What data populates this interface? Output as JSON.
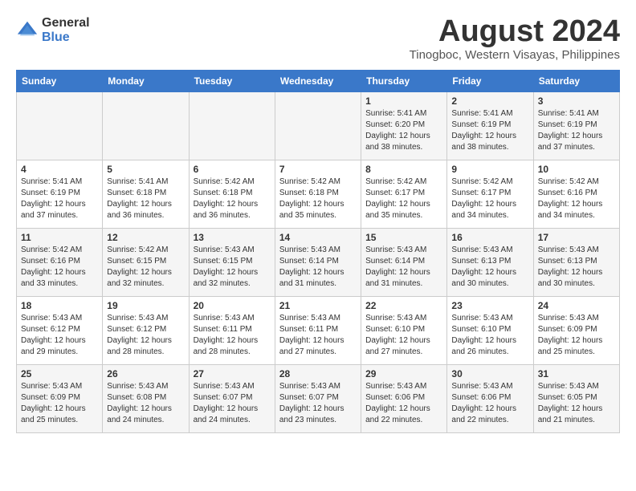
{
  "header": {
    "logo_general": "General",
    "logo_blue": "Blue",
    "month_year": "August 2024",
    "location": "Tinogboc, Western Visayas, Philippines"
  },
  "days_of_week": [
    "Sunday",
    "Monday",
    "Tuesday",
    "Wednesday",
    "Thursday",
    "Friday",
    "Saturday"
  ],
  "weeks": [
    [
      {
        "day": "",
        "info": ""
      },
      {
        "day": "",
        "info": ""
      },
      {
        "day": "",
        "info": ""
      },
      {
        "day": "",
        "info": ""
      },
      {
        "day": "1",
        "info": "Sunrise: 5:41 AM\nSunset: 6:20 PM\nDaylight: 12 hours\nand 38 minutes."
      },
      {
        "day": "2",
        "info": "Sunrise: 5:41 AM\nSunset: 6:19 PM\nDaylight: 12 hours\nand 38 minutes."
      },
      {
        "day": "3",
        "info": "Sunrise: 5:41 AM\nSunset: 6:19 PM\nDaylight: 12 hours\nand 37 minutes."
      }
    ],
    [
      {
        "day": "4",
        "info": "Sunrise: 5:41 AM\nSunset: 6:19 PM\nDaylight: 12 hours\nand 37 minutes."
      },
      {
        "day": "5",
        "info": "Sunrise: 5:41 AM\nSunset: 6:18 PM\nDaylight: 12 hours\nand 36 minutes."
      },
      {
        "day": "6",
        "info": "Sunrise: 5:42 AM\nSunset: 6:18 PM\nDaylight: 12 hours\nand 36 minutes."
      },
      {
        "day": "7",
        "info": "Sunrise: 5:42 AM\nSunset: 6:18 PM\nDaylight: 12 hours\nand 35 minutes."
      },
      {
        "day": "8",
        "info": "Sunrise: 5:42 AM\nSunset: 6:17 PM\nDaylight: 12 hours\nand 35 minutes."
      },
      {
        "day": "9",
        "info": "Sunrise: 5:42 AM\nSunset: 6:17 PM\nDaylight: 12 hours\nand 34 minutes."
      },
      {
        "day": "10",
        "info": "Sunrise: 5:42 AM\nSunset: 6:16 PM\nDaylight: 12 hours\nand 34 minutes."
      }
    ],
    [
      {
        "day": "11",
        "info": "Sunrise: 5:42 AM\nSunset: 6:16 PM\nDaylight: 12 hours\nand 33 minutes."
      },
      {
        "day": "12",
        "info": "Sunrise: 5:42 AM\nSunset: 6:15 PM\nDaylight: 12 hours\nand 32 minutes."
      },
      {
        "day": "13",
        "info": "Sunrise: 5:43 AM\nSunset: 6:15 PM\nDaylight: 12 hours\nand 32 minutes."
      },
      {
        "day": "14",
        "info": "Sunrise: 5:43 AM\nSunset: 6:14 PM\nDaylight: 12 hours\nand 31 minutes."
      },
      {
        "day": "15",
        "info": "Sunrise: 5:43 AM\nSunset: 6:14 PM\nDaylight: 12 hours\nand 31 minutes."
      },
      {
        "day": "16",
        "info": "Sunrise: 5:43 AM\nSunset: 6:13 PM\nDaylight: 12 hours\nand 30 minutes."
      },
      {
        "day": "17",
        "info": "Sunrise: 5:43 AM\nSunset: 6:13 PM\nDaylight: 12 hours\nand 30 minutes."
      }
    ],
    [
      {
        "day": "18",
        "info": "Sunrise: 5:43 AM\nSunset: 6:12 PM\nDaylight: 12 hours\nand 29 minutes."
      },
      {
        "day": "19",
        "info": "Sunrise: 5:43 AM\nSunset: 6:12 PM\nDaylight: 12 hours\nand 28 minutes."
      },
      {
        "day": "20",
        "info": "Sunrise: 5:43 AM\nSunset: 6:11 PM\nDaylight: 12 hours\nand 28 minutes."
      },
      {
        "day": "21",
        "info": "Sunrise: 5:43 AM\nSunset: 6:11 PM\nDaylight: 12 hours\nand 27 minutes."
      },
      {
        "day": "22",
        "info": "Sunrise: 5:43 AM\nSunset: 6:10 PM\nDaylight: 12 hours\nand 27 minutes."
      },
      {
        "day": "23",
        "info": "Sunrise: 5:43 AM\nSunset: 6:10 PM\nDaylight: 12 hours\nand 26 minutes."
      },
      {
        "day": "24",
        "info": "Sunrise: 5:43 AM\nSunset: 6:09 PM\nDaylight: 12 hours\nand 25 minutes."
      }
    ],
    [
      {
        "day": "25",
        "info": "Sunrise: 5:43 AM\nSunset: 6:09 PM\nDaylight: 12 hours\nand 25 minutes."
      },
      {
        "day": "26",
        "info": "Sunrise: 5:43 AM\nSunset: 6:08 PM\nDaylight: 12 hours\nand 24 minutes."
      },
      {
        "day": "27",
        "info": "Sunrise: 5:43 AM\nSunset: 6:07 PM\nDaylight: 12 hours\nand 24 minutes."
      },
      {
        "day": "28",
        "info": "Sunrise: 5:43 AM\nSunset: 6:07 PM\nDaylight: 12 hours\nand 23 minutes."
      },
      {
        "day": "29",
        "info": "Sunrise: 5:43 AM\nSunset: 6:06 PM\nDaylight: 12 hours\nand 22 minutes."
      },
      {
        "day": "30",
        "info": "Sunrise: 5:43 AM\nSunset: 6:06 PM\nDaylight: 12 hours\nand 22 minutes."
      },
      {
        "day": "31",
        "info": "Sunrise: 5:43 AM\nSunset: 6:05 PM\nDaylight: 12 hours\nand 21 minutes."
      }
    ]
  ]
}
